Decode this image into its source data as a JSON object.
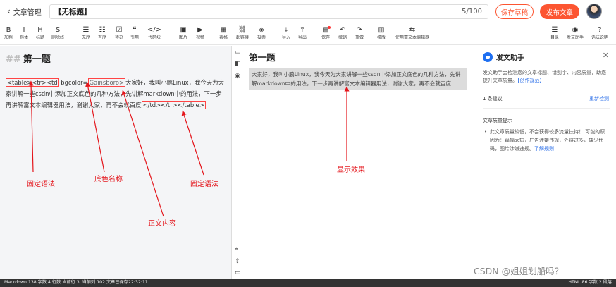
{
  "header": {
    "back_label": "文章管理",
    "title_value": "【无标题】",
    "title_count": "5/100",
    "save_draft": "保存草稿",
    "publish": "发布文章"
  },
  "toolbar": [
    {
      "icon": "B",
      "label": "加粗",
      "name": "bold"
    },
    {
      "icon": "I",
      "label": "斜体",
      "name": "italic"
    },
    {
      "icon": "H",
      "label": "标题",
      "name": "heading"
    },
    {
      "icon": "S",
      "label": "删除线",
      "name": "strikethrough"
    },
    {
      "icon": "☰",
      "label": "无序",
      "name": "unordered-list"
    },
    {
      "icon": "☷",
      "label": "有序",
      "name": "ordered-list"
    },
    {
      "icon": "☑",
      "label": "待办",
      "name": "todo"
    },
    {
      "icon": "❝",
      "label": "引用",
      "name": "quote"
    },
    {
      "icon": "</>",
      "label": "代码块",
      "name": "code-block"
    },
    {
      "icon": "▣",
      "label": "图片",
      "name": "image"
    },
    {
      "icon": "▶",
      "label": "视频",
      "name": "video"
    },
    {
      "icon": "▦",
      "label": "表格",
      "name": "table"
    },
    {
      "icon": "⛓",
      "label": "超链接",
      "name": "link"
    },
    {
      "icon": "◈",
      "label": "投票",
      "name": "vote"
    },
    {
      "icon": "⤓",
      "label": "导入",
      "name": "import"
    },
    {
      "icon": "⤒",
      "label": "导出",
      "name": "export"
    },
    {
      "icon": "▤",
      "label": "保存",
      "name": "save"
    },
    {
      "icon": "↶",
      "label": "撤销",
      "name": "undo"
    },
    {
      "icon": "↷",
      "label": "重做",
      "name": "redo"
    },
    {
      "icon": "▥",
      "label": "模版",
      "name": "template"
    },
    {
      "icon": "⇆",
      "label": "使用富文本编辑器",
      "name": "rich-text"
    },
    {
      "icon": "☰",
      "label": "目录",
      "name": "toc"
    },
    {
      "icon": "◉",
      "label": "发文助手",
      "name": "assistant"
    },
    {
      "icon": "?",
      "label": "语法说明",
      "name": "syntax-help"
    }
  ],
  "editor": {
    "heading_marks": "##",
    "heading": "第一题",
    "tag_open": "<table><tr><td",
    "attr": " bgcolor=",
    "color_name": "Gainsboro>",
    "body_1": "大家好，我叫小鹏Linux，我今天为大家讲解一些csdn中添加正文底色的几种方法，先讲解markdown中的用法，下一步再讲解富文本编辑器用法，谢谢大家，再不会就百度",
    "tag_close": "</td></tr></table>"
  },
  "preview": {
    "heading": "第一题",
    "content": "大家好，我叫小鹏Linux，我今天为大家讲解一些csdn中添加正文底色的几种方法，先讲解markdown中的用法，下一步再讲解富文本编辑器用法，谢谢大家，再不会就百度"
  },
  "assistant": {
    "title": "发文助手",
    "desc": "发文助手会检测您的文章标题、错别字、内容质量，助您提升文章质量。",
    "desc_link": "【创作规范】",
    "count": "1 条建议",
    "recheck": "重新检测",
    "sub_title": "文章质量提示",
    "tip": "此文章质量较低，不会获得较多流量扶持！ 可能的原因为：篇幅太短，广告涉嫌违规，外链过多，缺少代码，图片涉嫌违规。",
    "tip_link": "了解规则"
  },
  "annotations": {
    "fixed_syntax_left": "固定语法",
    "bg_color_name": "底色名称",
    "body_content": "正文内容",
    "fixed_syntax_right": "固定语法",
    "display_effect": "显示效果"
  },
  "statusbar": {
    "left": "Markdown  138 字数  4 行数  当前行 3, 当前列 102  文章已保存22:32:11",
    "right": "HTML  86 字数  2 段落"
  },
  "watermark": "CSDN @姐姐划船吗？",
  "colors": {
    "accent": "#fc5531",
    "annotation": "#e4161c",
    "link": "#2a6ee8"
  }
}
